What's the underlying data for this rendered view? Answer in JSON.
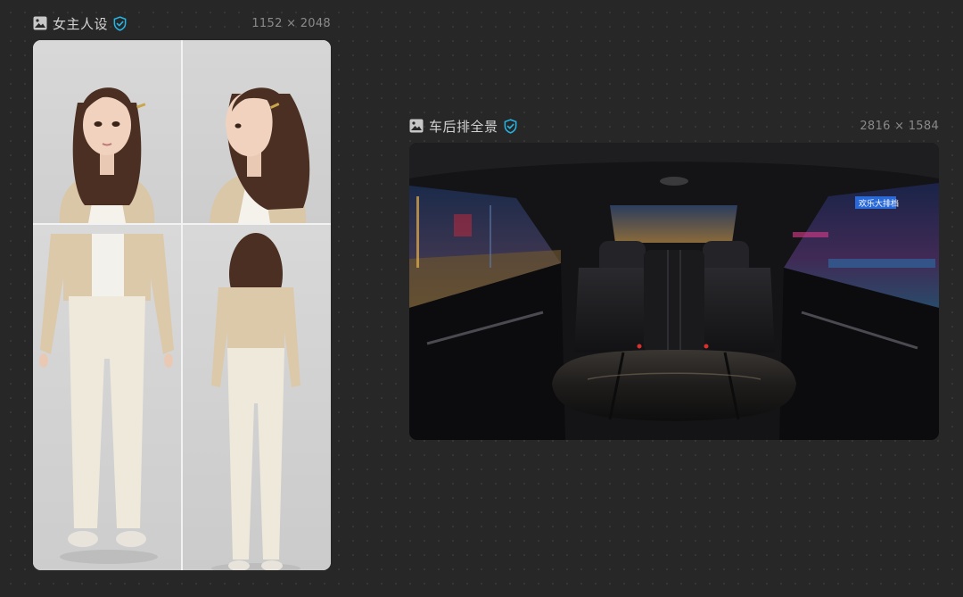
{
  "canvas": {
    "cards": [
      {
        "title": "女主人设",
        "dimensions": "1152 × 2048",
        "icon": "image-icon",
        "badge_icon": "verified-shield-icon",
        "image_description": "character turnaround sheet"
      },
      {
        "title": "车后排全景",
        "dimensions": "2816 × 1584",
        "icon": "image-icon",
        "badge_icon": "verified-shield-icon",
        "image_description": "car rear seat panorama",
        "sign_text": "欢乐大排档"
      }
    ]
  },
  "colors": {
    "background": "#272727",
    "verified_badge": "#26b6e6",
    "dims_text": "#8a8a8a"
  }
}
